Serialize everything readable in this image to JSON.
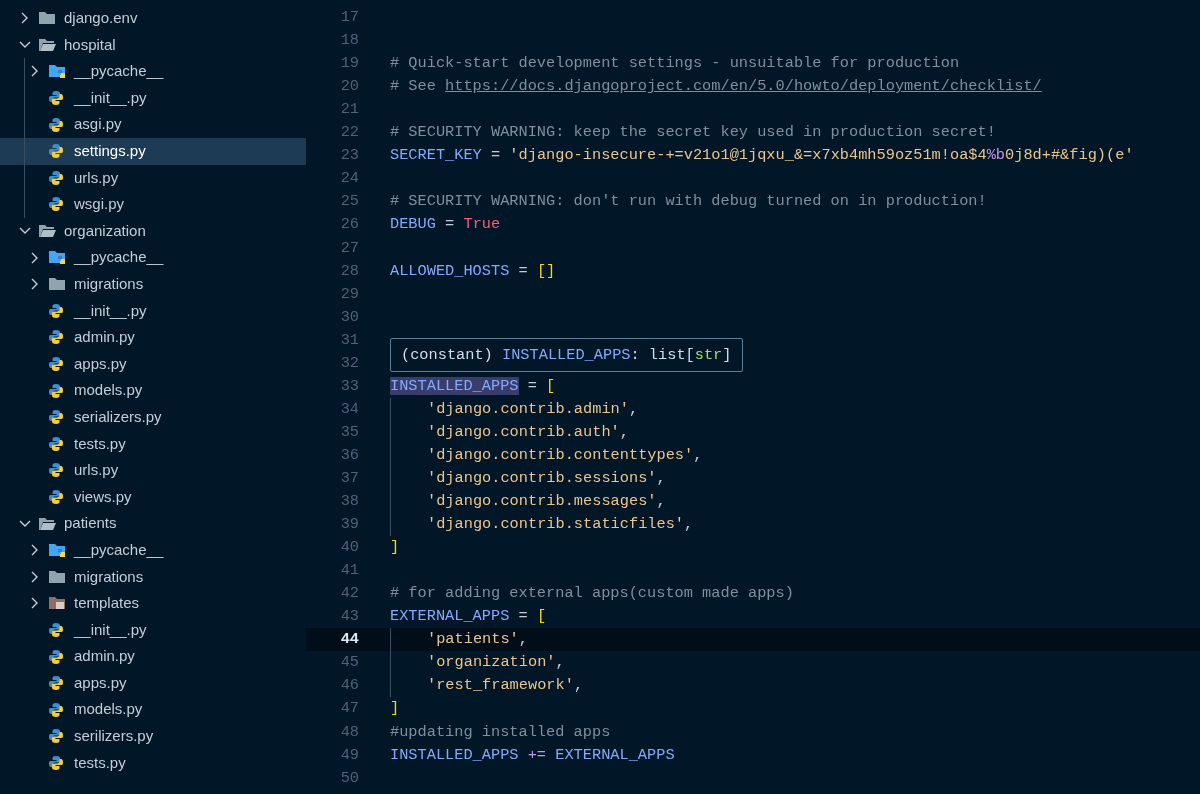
{
  "explorer": {
    "items": [
      {
        "kind": "folder",
        "label": "django.env",
        "expanded": false,
        "selected": false
      },
      {
        "kind": "folder",
        "label": "hospital",
        "expanded": true,
        "selected": false,
        "children": [
          {
            "kind": "python-folder",
            "label": "__pycache__",
            "expanded": false,
            "selected": false
          },
          {
            "kind": "python",
            "label": "__init__.py",
            "selected": false
          },
          {
            "kind": "python",
            "label": "asgi.py",
            "selected": false
          },
          {
            "kind": "python",
            "label": "settings.py",
            "selected": true
          },
          {
            "kind": "python",
            "label": "urls.py",
            "selected": false
          },
          {
            "kind": "python",
            "label": "wsgi.py",
            "selected": false
          }
        ]
      },
      {
        "kind": "folder",
        "label": "organization",
        "expanded": true,
        "selected": false,
        "children": [
          {
            "kind": "python-folder",
            "label": "__pycache__",
            "expanded": false,
            "selected": false
          },
          {
            "kind": "folder",
            "label": "migrations",
            "expanded": false,
            "selected": false
          },
          {
            "kind": "python",
            "label": "__init__.py",
            "selected": false
          },
          {
            "kind": "python",
            "label": "admin.py",
            "selected": false
          },
          {
            "kind": "python",
            "label": "apps.py",
            "selected": false
          },
          {
            "kind": "python",
            "label": "models.py",
            "selected": false
          },
          {
            "kind": "python",
            "label": "serializers.py",
            "selected": false
          },
          {
            "kind": "python",
            "label": "tests.py",
            "selected": false
          },
          {
            "kind": "python",
            "label": "urls.py",
            "selected": false
          },
          {
            "kind": "python",
            "label": "views.py",
            "selected": false
          }
        ]
      },
      {
        "kind": "folder",
        "label": "patients",
        "expanded": true,
        "selected": false,
        "children": [
          {
            "kind": "python-folder",
            "label": "__pycache__",
            "expanded": false,
            "selected": false
          },
          {
            "kind": "folder",
            "label": "migrations",
            "expanded": false,
            "selected": false
          },
          {
            "kind": "templates-folder",
            "label": "templates",
            "expanded": false,
            "selected": false
          },
          {
            "kind": "python",
            "label": "__init__.py",
            "selected": false
          },
          {
            "kind": "python",
            "label": "admin.py",
            "selected": false
          },
          {
            "kind": "python",
            "label": "apps.py",
            "selected": false
          },
          {
            "kind": "python",
            "label": "models.py",
            "selected": false
          },
          {
            "kind": "python",
            "label": "serilizers.py",
            "selected": false
          },
          {
            "kind": "python",
            "label": "tests.py",
            "selected": false
          }
        ]
      }
    ]
  },
  "editor": {
    "lines": [
      {
        "number": "17",
        "current": false
      },
      {
        "number": "18",
        "current": false
      },
      {
        "number": "19",
        "current": false,
        "tokens": [
          {
            "kind": "comment",
            "text": "# Quick-start development settings - unsuitable for production"
          }
        ]
      },
      {
        "number": "20",
        "current": false,
        "tokens": [
          {
            "kind": "comment",
            "text": "# See "
          },
          {
            "kind": "link",
            "text": "https://docs.djangoproject.com/en/5.0/howto/deployment/checklist/"
          }
        ]
      },
      {
        "number": "21",
        "current": false
      },
      {
        "number": "22",
        "current": false,
        "tokens": [
          {
            "kind": "comment",
            "text": "# SECURITY WARNING: keep the secret key used in production secret!"
          }
        ]
      },
      {
        "number": "23",
        "current": false,
        "tokens": [
          {
            "kind": "name",
            "text": "SECRET_KEY"
          },
          {
            "kind": "operator",
            "text": " = "
          },
          {
            "kind": "string",
            "text": "'django-insecure-+=v21o1@1jqxu_&=x7xb4mh59oz51m!oa$4"
          },
          {
            "kind": "format",
            "text": "%b"
          },
          {
            "kind": "string",
            "text": "0j8d+#&fig)(e'"
          }
        ]
      },
      {
        "number": "24",
        "current": false
      },
      {
        "number": "25",
        "current": false,
        "tokens": [
          {
            "kind": "comment",
            "text": "# SECURITY WARNING: don't run with debug turned on in production!"
          }
        ]
      },
      {
        "number": "26",
        "current": false,
        "tokens": [
          {
            "kind": "name",
            "text": "DEBUG"
          },
          {
            "kind": "operator",
            "text": " = "
          },
          {
            "kind": "keyword",
            "text": "True"
          }
        ]
      },
      {
        "number": "27",
        "current": false
      },
      {
        "number": "28",
        "current": false,
        "tokens": [
          {
            "kind": "name",
            "text": "ALLOWED_HOSTS"
          },
          {
            "kind": "operator",
            "text": " = "
          },
          {
            "kind": "bracket",
            "text": "[]"
          }
        ]
      },
      {
        "number": "29",
        "current": false
      },
      {
        "number": "30",
        "current": false
      },
      {
        "number": "31",
        "current": false
      },
      {
        "number": "32",
        "current": false
      },
      {
        "number": "33",
        "current": false,
        "tokens": [
          {
            "kind": "highlight",
            "text": "INSTALLED_APPS"
          },
          {
            "kind": "operator",
            "text": " = "
          },
          {
            "kind": "bracket",
            "text": "["
          }
        ]
      },
      {
        "number": "34",
        "current": false,
        "indented": true,
        "tokens": [
          {
            "kind": "string",
            "text": "'django.contrib.admin'"
          },
          {
            "kind": "operator",
            "text": ","
          }
        ]
      },
      {
        "number": "35",
        "current": false,
        "indented": true,
        "tokens": [
          {
            "kind": "string",
            "text": "'django.contrib.auth'"
          },
          {
            "kind": "operator",
            "text": ","
          }
        ]
      },
      {
        "number": "36",
        "current": false,
        "indented": true,
        "tokens": [
          {
            "kind": "string",
            "text": "'django.contrib.contenttypes'"
          },
          {
            "kind": "operator",
            "text": ","
          }
        ]
      },
      {
        "number": "37",
        "current": false,
        "indented": true,
        "tokens": [
          {
            "kind": "string",
            "text": "'django.contrib.sessions'"
          },
          {
            "kind": "operator",
            "text": ","
          }
        ]
      },
      {
        "number": "38",
        "current": false,
        "indented": true,
        "tokens": [
          {
            "kind": "string",
            "text": "'django.contrib.messages'"
          },
          {
            "kind": "operator",
            "text": ","
          }
        ]
      },
      {
        "number": "39",
        "current": false,
        "indented": true,
        "tokens": [
          {
            "kind": "string",
            "text": "'django.contrib.staticfiles'"
          },
          {
            "kind": "operator",
            "text": ","
          }
        ]
      },
      {
        "number": "40",
        "current": false,
        "tokens": [
          {
            "kind": "bracket",
            "text": "]"
          }
        ]
      },
      {
        "number": "41",
        "current": false
      },
      {
        "number": "42",
        "current": false,
        "tokens": [
          {
            "kind": "comment",
            "text": "# for adding external apps(custom made apps)"
          }
        ]
      },
      {
        "number": "43",
        "current": false,
        "tokens": [
          {
            "kind": "name",
            "text": "EXTERNAL_APPS"
          },
          {
            "kind": "operator",
            "text": " = "
          },
          {
            "kind": "bracket",
            "text": "["
          }
        ]
      },
      {
        "number": "44",
        "current": true,
        "indented": true,
        "tokens": [
          {
            "kind": "string",
            "text": "'patients'"
          },
          {
            "kind": "operator",
            "text": ","
          }
        ]
      },
      {
        "number": "45",
        "current": false,
        "indented": true,
        "tokens": [
          {
            "kind": "string",
            "text": "'organization'"
          },
          {
            "kind": "operator",
            "text": ","
          }
        ]
      },
      {
        "number": "46",
        "current": false,
        "indented": true,
        "tokens": [
          {
            "kind": "string",
            "text": "'rest_framework'"
          },
          {
            "kind": "operator",
            "text": ","
          }
        ]
      },
      {
        "number": "47",
        "current": false,
        "tokens": [
          {
            "kind": "bracket",
            "text": "]"
          }
        ]
      },
      {
        "number": "48",
        "current": false,
        "tokens": [
          {
            "kind": "comment",
            "text": "#updating installed apps"
          }
        ]
      },
      {
        "number": "49",
        "current": false,
        "tokens": [
          {
            "kind": "name",
            "text": "INSTALLED_APPS"
          },
          {
            "kind": "keyword-op",
            "text": " += "
          },
          {
            "kind": "name",
            "text": "EXTERNAL_APPS"
          }
        ]
      },
      {
        "number": "50",
        "current": false
      }
    ],
    "hover": {
      "tokens": [
        {
          "kind": "plain",
          "text": "(constant) "
        },
        {
          "kind": "name",
          "text": "INSTALLED_APPS"
        },
        {
          "kind": "plain",
          "text": ": list["
        },
        {
          "kind": "type",
          "text": "str"
        },
        {
          "kind": "plain",
          "text": "]"
        }
      ]
    }
  }
}
